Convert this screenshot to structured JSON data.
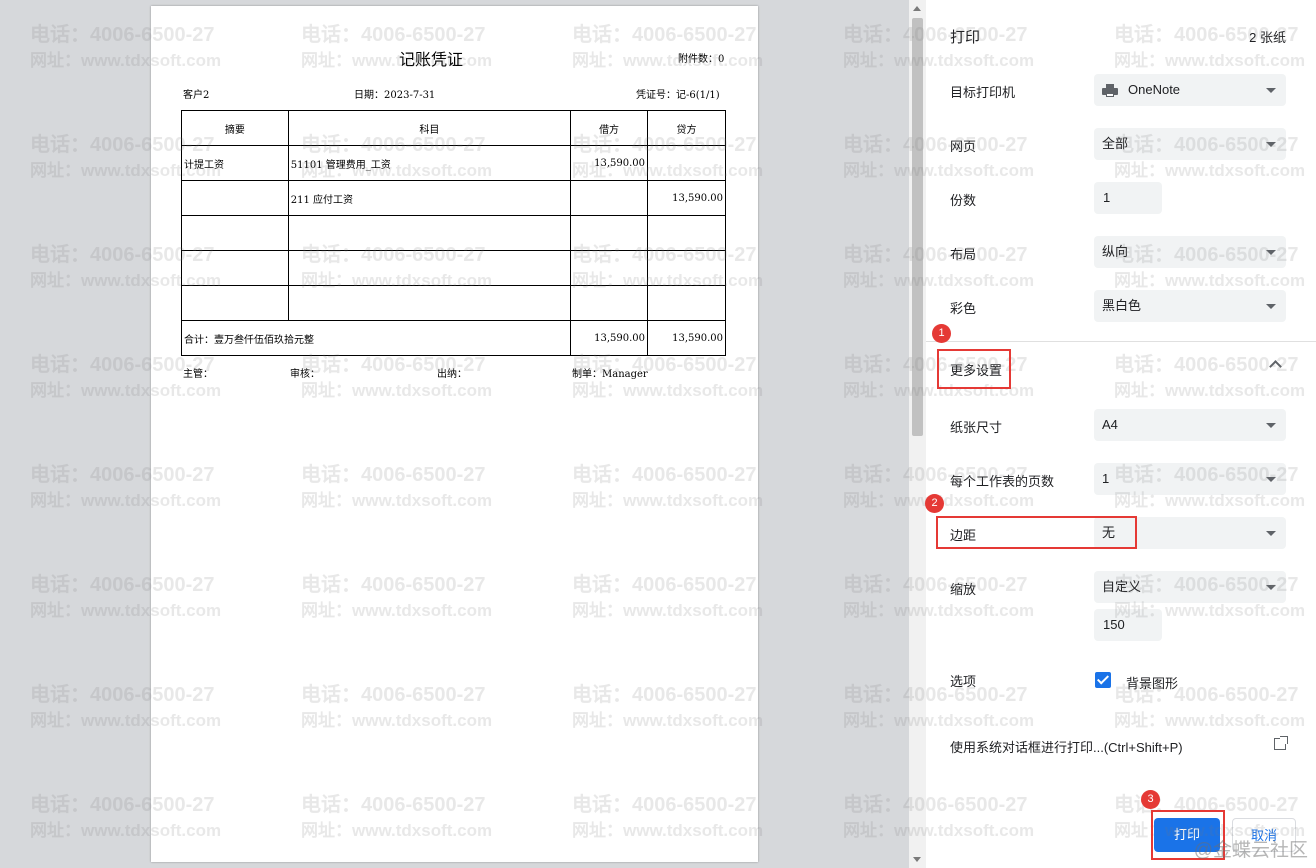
{
  "watermark": {
    "line1": "电话：4006-6500-27",
    "line2": "网址：www.tdxsoft.com"
  },
  "corner_watermark": "@金蝶云社区",
  "voucher": {
    "title": "记账凭证",
    "attachments": "附件数：0",
    "customer": "客户2",
    "date": "日期：2023-7-31",
    "number": "凭证号：记-6(1/1)",
    "headers": [
      "摘要",
      "科目",
      "借方",
      "贷方"
    ],
    "rows": [
      {
        "summary": "计提工资",
        "account": "51101 管理费用_工资",
        "debit": "13,590.00",
        "credit": ""
      },
      {
        "summary": "",
        "account": "211 应付工资",
        "debit": "",
        "credit": "13,590.00"
      },
      {
        "summary": "",
        "account": "",
        "debit": "",
        "credit": ""
      },
      {
        "summary": "",
        "account": "",
        "debit": "",
        "credit": ""
      },
      {
        "summary": "",
        "account": "",
        "debit": "",
        "credit": ""
      }
    ],
    "total_label": "合计：壹万叁仟伍佰玖拾元整",
    "total_debit": "13,590.00",
    "total_credit": "13,590.00",
    "signatures": {
      "supervisor": "主管：",
      "reviewer": "审核：",
      "cashier": "出纳：",
      "preparer": "制单：Manager"
    }
  },
  "panel": {
    "title": "打印",
    "sheet_count": "2 张纸",
    "destination": {
      "label": "目标打印机",
      "value": "OneNote",
      "icon": "printer-icon"
    },
    "pages": {
      "label": "网页",
      "value": "全部"
    },
    "copies": {
      "label": "份数",
      "value": "1"
    },
    "layout": {
      "label": "布局",
      "value": "纵向"
    },
    "color": {
      "label": "彩色",
      "value": "黑白色"
    },
    "more_settings": {
      "label": "更多设置"
    },
    "paper_size": {
      "label": "纸张尺寸",
      "value": "A4"
    },
    "pages_per_sheet": {
      "label": "每个工作表的页数",
      "value": "1"
    },
    "margins": {
      "label": "边距",
      "value": "无"
    },
    "scale": {
      "label": "缩放",
      "value": "自定义",
      "custom_value": "150"
    },
    "options": {
      "label": "选项",
      "background_graphics": "背景图形",
      "checked": true
    },
    "system_dialog": "使用系统对话框进行打印...(Ctrl+Shift+P)",
    "print_button": "打印",
    "cancel_button": "取消"
  },
  "annotations": {
    "badge1": "1",
    "badge2": "2",
    "badge3": "3",
    "highlight_color": "#e53935"
  }
}
